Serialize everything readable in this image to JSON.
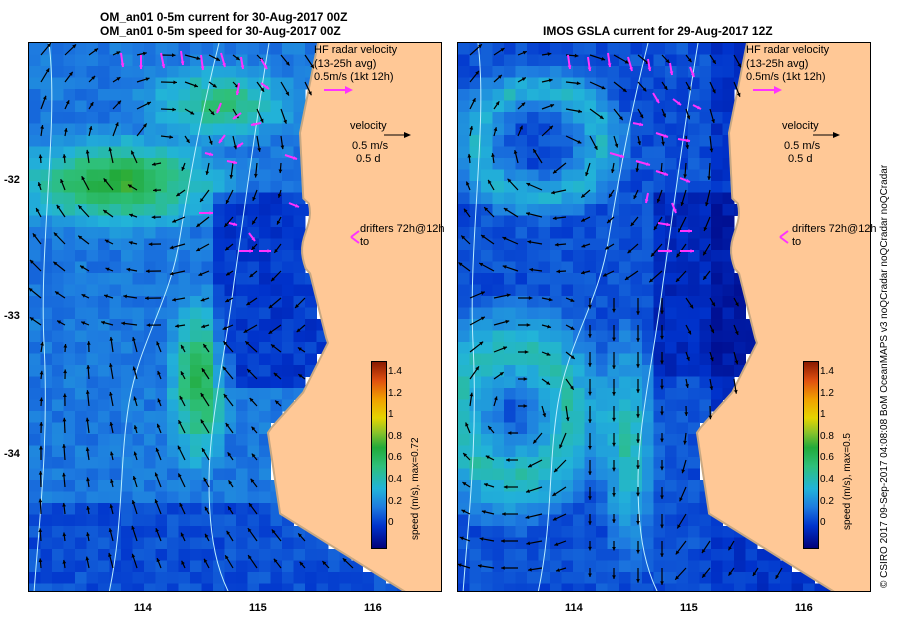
{
  "left_panel": {
    "title_line1": "OM_an01 0-5m current for 30-Aug-2017 00Z",
    "title_line2": "OM_an01 0-5m speed for 30-Aug-2017 00Z",
    "hf_radar": [
      "HF radar velocity",
      "(13-25h avg)",
      "0.5m/s (1kt 12h)"
    ],
    "velocity_key": [
      "velocity",
      "0.5 m/s",
      "0.5 d"
    ],
    "drifters": [
      "drifters 72h@12h",
      "to"
    ],
    "colorbar_label": "speed (m/s), max=0.72",
    "colorbar_ticks": [
      "1.4",
      "1.2",
      "1",
      "0.8",
      "0.6",
      "0.4",
      "0.2",
      "0"
    ],
    "x_ticks": [
      "114",
      "115",
      "116"
    ],
    "y_ticks": [
      "-32",
      "-33",
      "-34"
    ]
  },
  "right_panel": {
    "title_line1": "IMOS GSLA current for 29-Aug-2017 12Z",
    "hf_radar": [
      "HF radar velocity",
      "(13-25h avg)",
      "0.5m/s (1kt 12h)"
    ],
    "velocity_key": [
      "velocity",
      "0.5 m/s",
      "0.5 d"
    ],
    "drifters": [
      "drifters 72h@12h",
      "to"
    ],
    "colorbar_label": "speed (m/s), max=0.5",
    "colorbar_ticks": [
      "1.4",
      "1.2",
      "1",
      "0.8",
      "0.6",
      "0.4",
      "0.2",
      "0"
    ],
    "x_ticks": [
      "114",
      "115",
      "116"
    ]
  },
  "credit": "© CSIRO 2017   09-Sep-2017 04:08:08 BoM OceanMAPS v3 noQCradar noQCradar noQCradar",
  "colors": {
    "land": "#ffc896",
    "coast_shelf": "#c8a882",
    "arrow": "#000000",
    "radar": "#ff33ff",
    "isobath": "#bbeeff"
  }
}
